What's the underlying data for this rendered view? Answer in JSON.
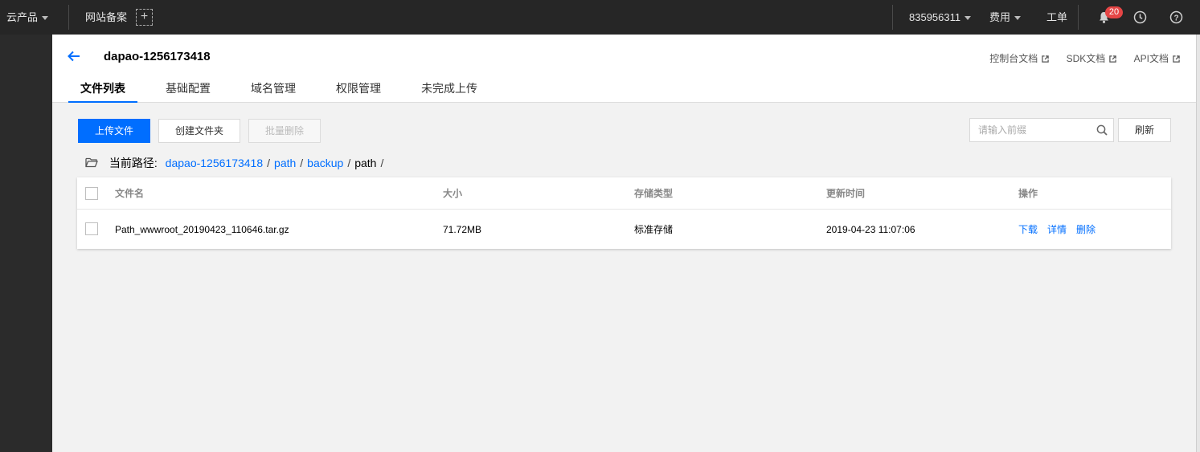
{
  "topbar": {
    "products": "云产品",
    "beian": "网站备案",
    "account": "835956311",
    "billing": "费用",
    "ticket": "工单",
    "notifications": "20"
  },
  "header": {
    "bucket_name": "dapao-1256173418",
    "doc_links": [
      "控制台文档",
      "SDK文档",
      "API文档"
    ]
  },
  "tabs": [
    "文件列表",
    "基础配置",
    "域名管理",
    "权限管理",
    "未完成上传"
  ],
  "toolbar": {
    "upload": "上传文件",
    "create_folder": "创建文件夹",
    "batch_delete": "批量删除",
    "search_placeholder": "请输入前缀",
    "refresh": "刷新"
  },
  "path": {
    "label": "当前路径:",
    "crumbs": [
      "dapao-1256173418",
      "path",
      "backup"
    ],
    "current": "path"
  },
  "table": {
    "columns": [
      "文件名",
      "大小",
      "存储类型",
      "更新时间",
      "操作"
    ],
    "rows": [
      {
        "name": "Path_wwwroot_20190423_110646.tar.gz",
        "size": "71.72MB",
        "storage": "标准存储",
        "updated": "2019-04-23 11:07:06",
        "actions": [
          "下载",
          "详情",
          "删除"
        ]
      }
    ]
  },
  "colors": {
    "primary": "#006eff",
    "topbar": "#262626",
    "badge": "#e54545"
  }
}
